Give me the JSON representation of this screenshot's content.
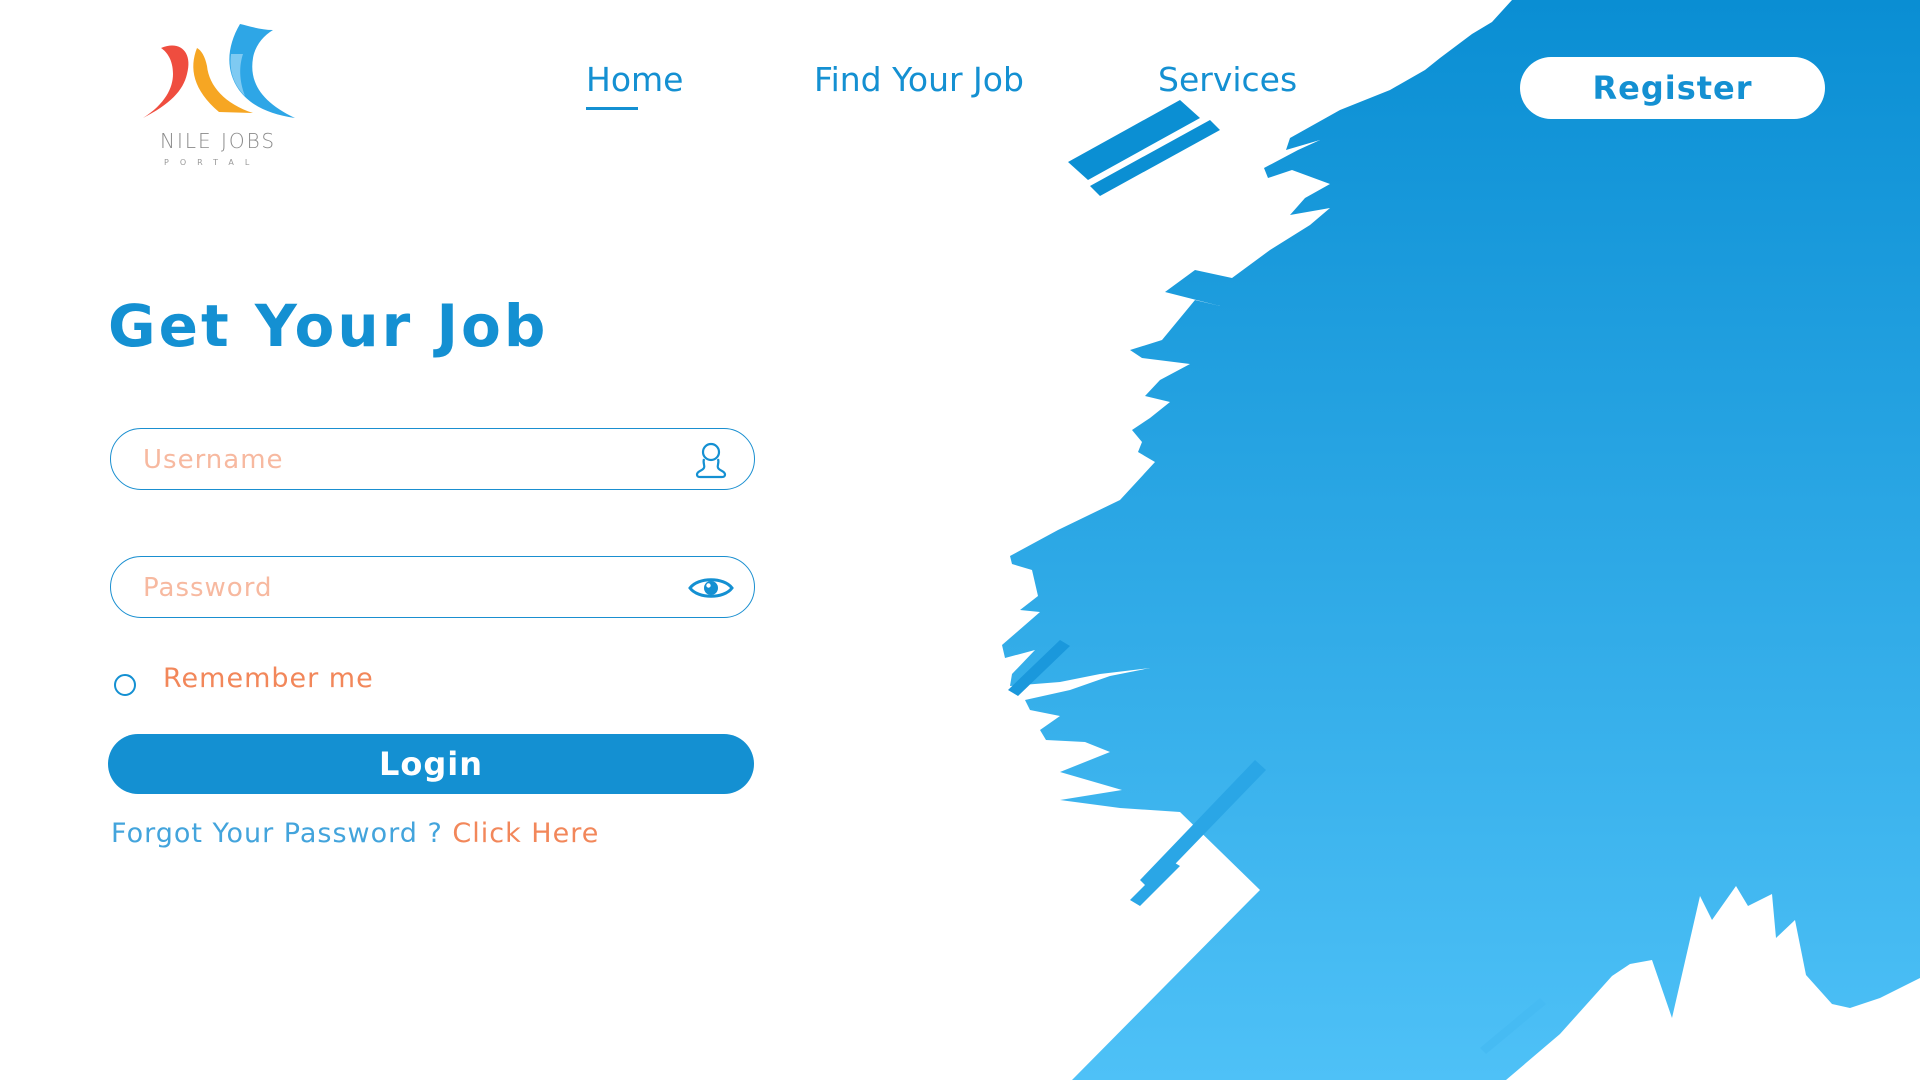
{
  "brand": {
    "name": "NILE JOBS",
    "sub": "PORTAL",
    "colors": {
      "primary": "#1490d2",
      "accent": "#f2875a",
      "logo_red": "#ef4d3f",
      "logo_orange": "#f6a623",
      "logo_blue": "#2ea6e6"
    }
  },
  "nav": {
    "home": "Home",
    "find_job": "Find Your Job",
    "services": "Services",
    "active": "Home",
    "register": "Register"
  },
  "login": {
    "title": "Get Your Job",
    "username_placeholder": "Username",
    "username_icon": "user-icon",
    "password_placeholder": "Password",
    "password_icon": "eye-icon",
    "remember_label": "Remember me",
    "remember_checked": false,
    "button": "Login",
    "forgot_text": "Forgot Your Password ?",
    "forgot_link": "Click Here"
  }
}
